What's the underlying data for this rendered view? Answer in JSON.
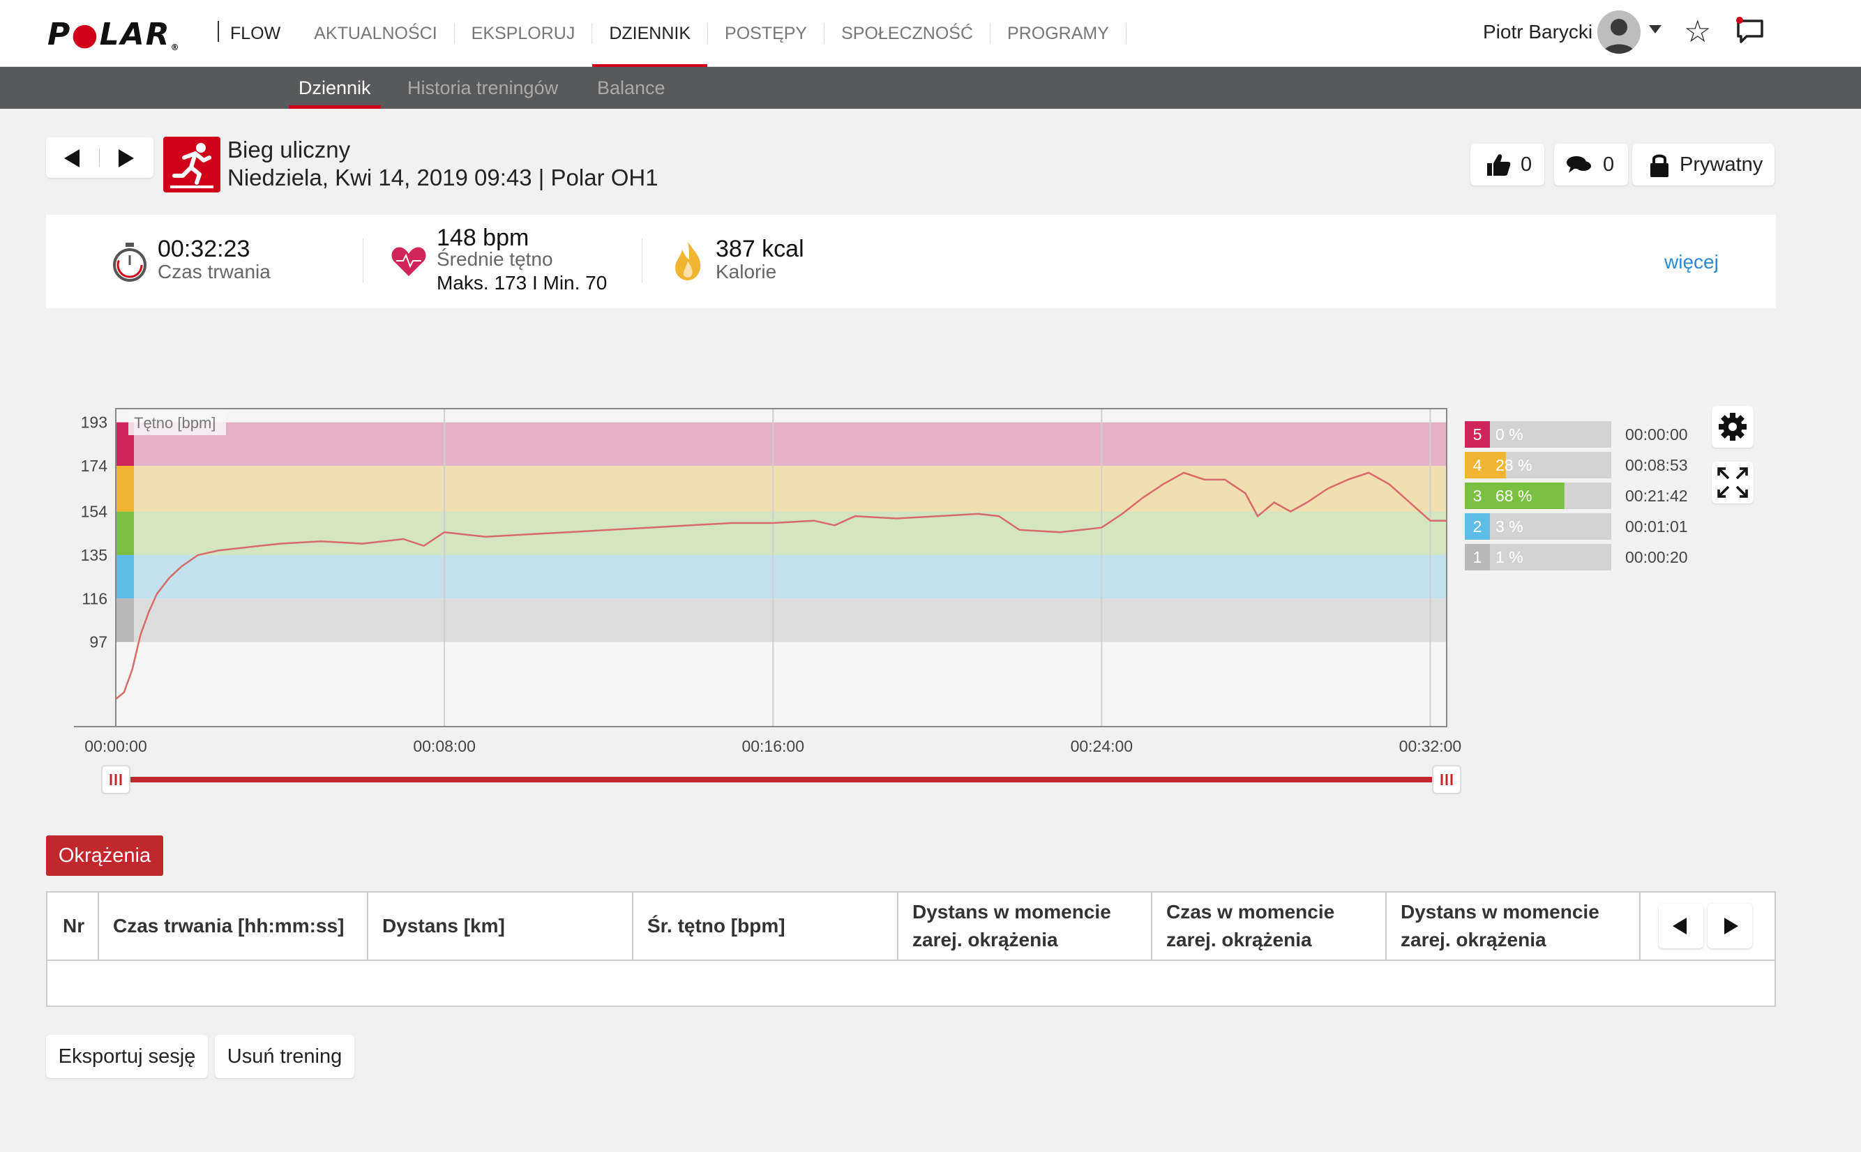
{
  "brand": {
    "logo": "POLAR",
    "product": "FLOW"
  },
  "nav": {
    "items": [
      "AKTUALNOŚCI",
      "EKSPLORUJ",
      "DZIENNIK",
      "POSTĘPY",
      "SPOŁECZNOŚĆ",
      "PROGRAMY"
    ],
    "active": "DZIENNIK"
  },
  "user": {
    "name": "Piotr Barycki"
  },
  "subnav": {
    "items": [
      "Dziennik",
      "Historia treningów",
      "Balance"
    ],
    "active": "Dziennik"
  },
  "session": {
    "sport": "Bieg uliczny",
    "details": "Niedziela, Kwi 14, 2019 09:43 | Polar OH1",
    "likes": "0",
    "comments": "0",
    "privacy": "Prywatny"
  },
  "summary": {
    "duration": {
      "value": "00:32:23",
      "label": "Czas trwania"
    },
    "heart": {
      "value": "148 bpm",
      "label": "Średnie tętno",
      "minmax": "Maks. 173  I  Min. 70"
    },
    "calories": {
      "value": "387 kcal",
      "label": "Kalorie"
    },
    "more": "więcej"
  },
  "chart_data": {
    "type": "line",
    "series_label": "Tętno [bpm]",
    "y_ticks": [
      193,
      174,
      154,
      135,
      116,
      97
    ],
    "x_ticks": [
      "00:00:00",
      "00:08:00",
      "00:16:00",
      "00:24:00",
      "00:32:00"
    ],
    "xlim_min": [
      0,
      32.4
    ],
    "ylim": [
      60,
      199
    ],
    "zones": [
      {
        "zone": "5",
        "from": 174,
        "to": 193,
        "color": "#e4b1c7",
        "marker": "#d0245a"
      },
      {
        "zone": "4",
        "from": 154,
        "to": 174,
        "color": "#f2dfb1",
        "marker": "#f2b531"
      },
      {
        "zone": "3",
        "from": 135,
        "to": 154,
        "color": "#d3e6bf",
        "marker": "#7ac143"
      },
      {
        "zone": "2",
        "from": 116,
        "to": 135,
        "color": "#c2e1ec",
        "marker": "#5ebde8"
      },
      {
        "zone": "1",
        "from": 97,
        "to": 116,
        "color": "#dcdcdc",
        "marker": "#b8b8b8"
      }
    ],
    "x": [
      0,
      0.2,
      0.4,
      0.6,
      0.8,
      1.0,
      1.3,
      1.6,
      2.0,
      2.5,
      3.0,
      3.5,
      4.0,
      5.0,
      6.0,
      7.0,
      7.5,
      8.0,
      9.0,
      10.0,
      11.0,
      12.0,
      13.0,
      14.0,
      15.0,
      16.0,
      17.0,
      17.5,
      18.0,
      19.0,
      20.0,
      21.0,
      21.5,
      22.0,
      23.0,
      24.0,
      24.5,
      25.0,
      25.5,
      26.0,
      26.5,
      27.0,
      27.5,
      27.8,
      28.2,
      28.6,
      29.0,
      29.5,
      30.0,
      30.5,
      31.0,
      31.5,
      32.0,
      32.4
    ],
    "y": [
      72,
      75,
      85,
      100,
      110,
      118,
      125,
      130,
      135,
      137,
      138,
      139,
      140,
      141,
      140,
      142,
      139,
      145,
      143,
      144,
      145,
      146,
      147,
      148,
      149,
      149,
      150,
      148,
      152,
      151,
      152,
      153,
      152,
      146,
      145,
      147,
      153,
      160,
      166,
      171,
      168,
      168,
      162,
      152,
      158,
      154,
      158,
      164,
      168,
      171,
      166,
      158,
      150,
      150
    ],
    "zone_stats": [
      {
        "zone": "5",
        "percent": "0 %",
        "pct": 0,
        "time": "00:00:00"
      },
      {
        "zone": "4",
        "percent": "28 %",
        "pct": 28,
        "time": "00:08:53"
      },
      {
        "zone": "3",
        "percent": "68 %",
        "pct": 68,
        "time": "00:21:42"
      },
      {
        "zone": "2",
        "percent": "3 %",
        "pct": 3,
        "time": "00:01:01"
      },
      {
        "zone": "1",
        "percent": "1 %",
        "pct": 1,
        "time": "00:00:20"
      }
    ]
  },
  "laps": {
    "tab": "Okrążenia",
    "columns": [
      "Nr",
      "Czas trwania [hh:mm:ss]",
      "Dystans [km]",
      "Śr. tętno [bpm]",
      "Dystans w momencie zarej. okrążenia",
      "Czas w momencie zarej. okrążenia",
      "Dystans w momencie zarej. okrążenia"
    ]
  },
  "actions": {
    "export": "Eksportuj sesję",
    "delete": "Usuń trening"
  }
}
